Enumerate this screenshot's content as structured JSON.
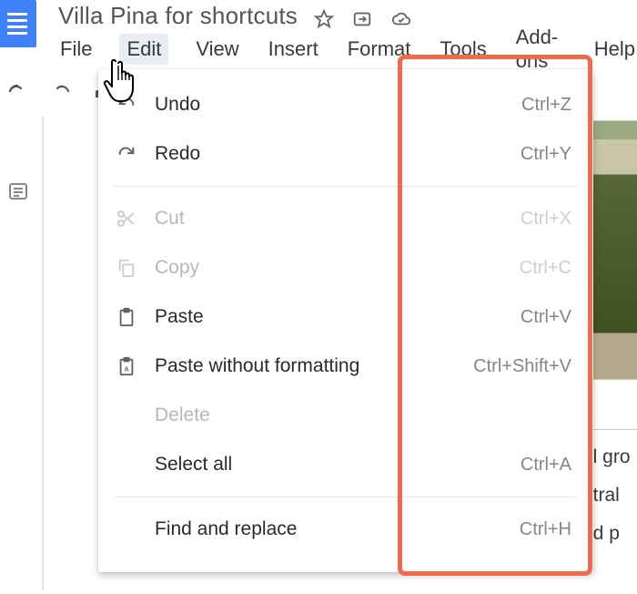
{
  "doc": {
    "title": "Villa Pina for shortcuts"
  },
  "menu": {
    "items": [
      "File",
      "Edit",
      "View",
      "Insert",
      "Format",
      "Tools",
      "Add-ons",
      "Help"
    ],
    "active_index": 1
  },
  "edit_menu": {
    "undo": {
      "label": "Undo",
      "shortcut": "Ctrl+Z"
    },
    "redo": {
      "label": "Redo",
      "shortcut": "Ctrl+Y"
    },
    "cut": {
      "label": "Cut",
      "shortcut": "Ctrl+X",
      "disabled": true
    },
    "copy": {
      "label": "Copy",
      "shortcut": "Ctrl+C",
      "disabled": true
    },
    "paste": {
      "label": "Paste",
      "shortcut": "Ctrl+V"
    },
    "paste_plain": {
      "label": "Paste without formatting",
      "shortcut": "Ctrl+Shift+V"
    },
    "delete": {
      "label": "Delete",
      "disabled": true
    },
    "select_all": {
      "label": "Select all",
      "shortcut": "Ctrl+A"
    },
    "find_replace": {
      "label": "Find and replace",
      "shortcut": "Ctrl+H"
    }
  },
  "bg_text": {
    "line1": "ul gro",
    "line2": "ntral",
    "line3": "nd p"
  }
}
